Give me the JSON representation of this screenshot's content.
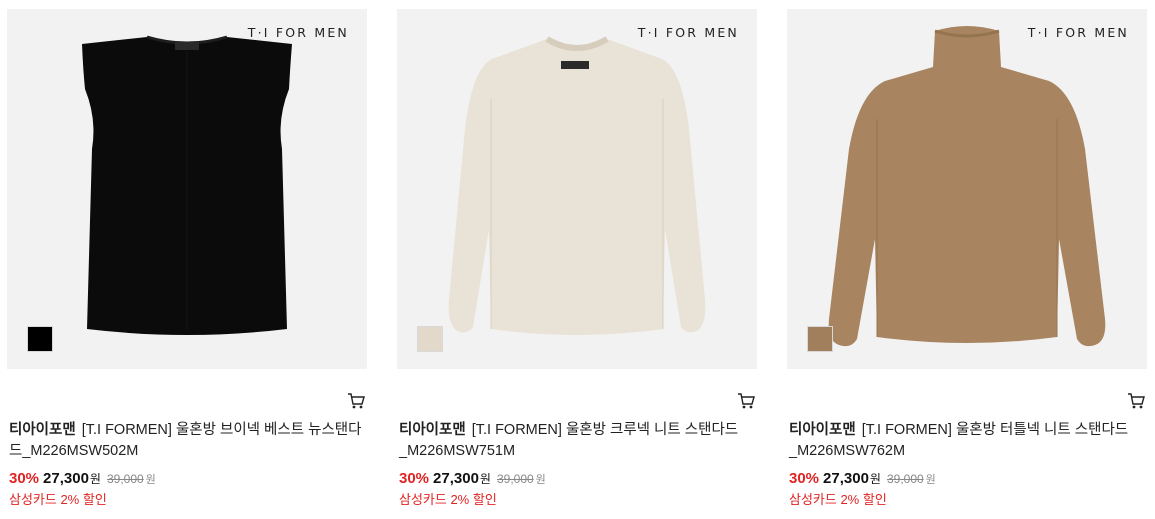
{
  "products": [
    {
      "brand_mark": "T·I FOR MEN",
      "swatch_color": "#000000",
      "garment_color": "#0b0b0b",
      "brand": "티아이포맨",
      "name": "[T.I FORMEN] 울혼방 브이넥 베스트 뉴스탠다드_M226MSW502M",
      "discount_rate": "30%",
      "price": "27,300",
      "price_unit": "원",
      "original_price": "39,000",
      "original_unit": "원",
      "card_discount": "삼성카드 2% 할인"
    },
    {
      "brand_mark": "T·I FOR MEN",
      "swatch_color": "#e2d9cb",
      "garment_color": "#e9e2d6",
      "brand": "티아이포맨",
      "name": "[T.I FORMEN] 울혼방 크루넥 니트 스탠다드_M226MSW751M",
      "discount_rate": "30%",
      "price": "27,300",
      "price_unit": "원",
      "original_price": "39,000",
      "original_unit": "원",
      "card_discount": "삼성카드 2% 할인"
    },
    {
      "brand_mark": "T·I FOR MEN",
      "swatch_color": "#a17e5c",
      "garment_color": "#a88460",
      "brand": "티아이포맨",
      "name": "[T.I FORMEN] 울혼방 터틀넥 니트 스탠다드_M226MSW762M",
      "discount_rate": "30%",
      "price": "27,300",
      "price_unit": "원",
      "original_price": "39,000",
      "original_unit": "원",
      "card_discount": "삼성카드 2% 할인"
    }
  ],
  "icons": {
    "cart": "cart-icon"
  }
}
